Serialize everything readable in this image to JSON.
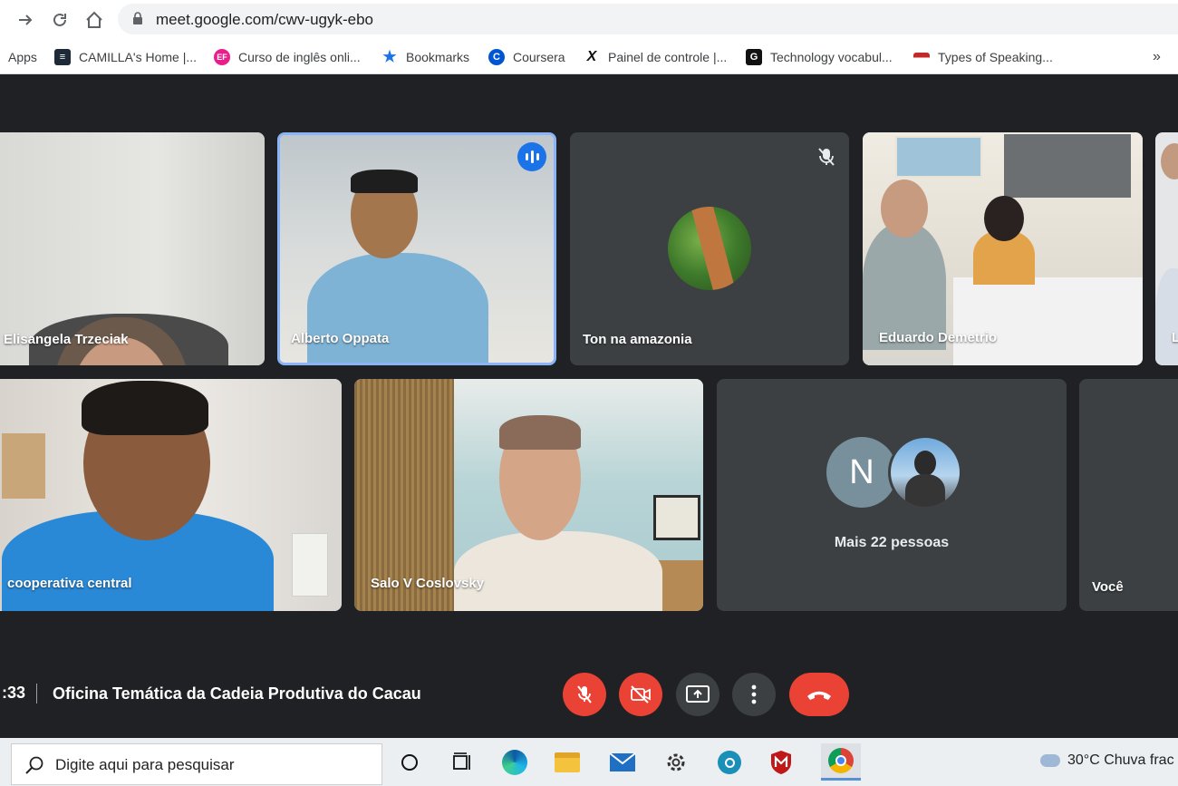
{
  "browser": {
    "url": "meet.google.com/cwv-ugyk-ebo",
    "bookmarks": [
      {
        "label": "Apps",
        "icon": "apps-grid-icon"
      },
      {
        "label": "CAMILLA's Home |...",
        "icon": "camilla-site-icon"
      },
      {
        "label": "Curso de inglês onli...",
        "icon": "ef-icon"
      },
      {
        "label": "Bookmarks",
        "icon": "star-icon"
      },
      {
        "label": "Coursera",
        "icon": "coursera-icon"
      },
      {
        "label": "Painel de controle |...",
        "icon": "x-site-icon"
      },
      {
        "label": "Technology vocabul...",
        "icon": "g-site-icon"
      },
      {
        "label": "Types of Speaking...",
        "icon": "flag-icon"
      }
    ],
    "overflow": "»"
  },
  "tiles": {
    "row1": [
      {
        "name": "Elisangela Trzeciak",
        "speaking": false,
        "muted": false
      },
      {
        "name": "Alberto Oppata",
        "speaking": true,
        "muted": false
      },
      {
        "name": "Ton na amazonia",
        "speaking": false,
        "muted": true
      },
      {
        "name": "Eduardo Demetrio",
        "speaking": false,
        "muted": false
      },
      {
        "name": "L",
        "speaking": false,
        "muted": false
      }
    ],
    "row2": [
      {
        "name": "cooperativa central"
      },
      {
        "name": "Salo V Coslovsky"
      },
      {
        "name": "Mais 22 pessoas",
        "avatar_letter": "N"
      },
      {
        "name": "Você"
      }
    ]
  },
  "meeting_bar": {
    "time": ":33",
    "title": "Oficina Temática da Cadeia Produtiva do Cacau",
    "controls": [
      "mic-off-icon",
      "camera-off-icon",
      "present-screen-icon",
      "more-vert-icon",
      "hang-up-icon"
    ]
  },
  "taskbar": {
    "search_placeholder": "Digite aqui para pesquisar",
    "weather": "30°C  Chuva frac"
  },
  "colors": {
    "meet_bg": "#202124",
    "tile_bg": "#3c4043",
    "accent_blue": "#1a73e8",
    "danger_red": "#ea4335"
  }
}
